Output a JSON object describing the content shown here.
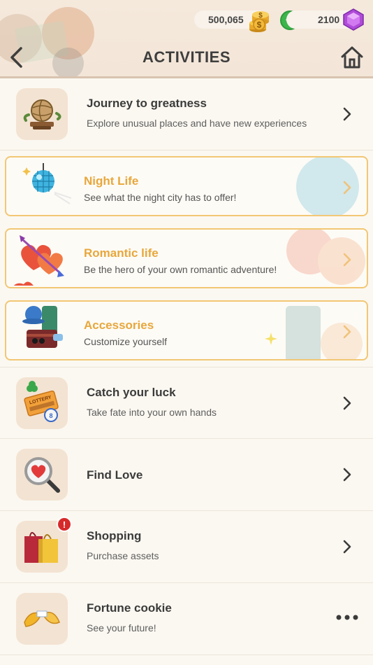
{
  "header": {
    "title": "ACTIVITIES",
    "coins": "500,065",
    "gems": "2100",
    "icons": {
      "back": "chevron-left-icon",
      "home": "home-icon",
      "coins": "coin-stack-icon",
      "add": "plus-icon",
      "gems": "gem-icon"
    }
  },
  "colors": {
    "header_bg": "#f3e6d8",
    "featured_border": "#f2c774",
    "featured_title": "#e8a73c",
    "add_button": "#3cb54a",
    "alert_badge": "#d62a2a"
  },
  "activities": [
    {
      "title": "Journey to greatness",
      "subtitle": "Explore unusual places and have new experiences",
      "icon": "globe-icon",
      "featured": false,
      "action": "chevron-right-icon"
    },
    {
      "title": "Night Life",
      "subtitle": "See what the night city has to offer!",
      "icon": "disco-ball-icon",
      "featured": true,
      "action": "chevron-right-icon"
    },
    {
      "title": "Romantic life",
      "subtitle": "Be the hero of your own romantic adventure!",
      "icon": "hearts-arrow-icon",
      "featured": true,
      "action": "chevron-right-icon"
    },
    {
      "title": "Accessories",
      "subtitle": "Customize yourself",
      "icon": "accessories-icon",
      "featured": true,
      "action": "chevron-right-icon"
    },
    {
      "title": "Catch your luck",
      "subtitle": "Take fate into your own hands",
      "icon": "lottery-ticket-icon",
      "featured": false,
      "action": "chevron-right-icon",
      "ticket_text": "LOTTERY"
    },
    {
      "title": "Find Love",
      "subtitle": "",
      "icon": "magnifier-heart-icon",
      "featured": false,
      "action": "chevron-right-icon"
    },
    {
      "title": "Shopping",
      "subtitle": "Purchase assets",
      "icon": "shopping-bags-icon",
      "featured": false,
      "action": "chevron-right-icon",
      "badge": "!"
    },
    {
      "title": "Fortune cookie",
      "subtitle": "See your future!",
      "icon": "fortune-cookie-icon",
      "featured": false,
      "action": "more-dots-icon"
    }
  ]
}
